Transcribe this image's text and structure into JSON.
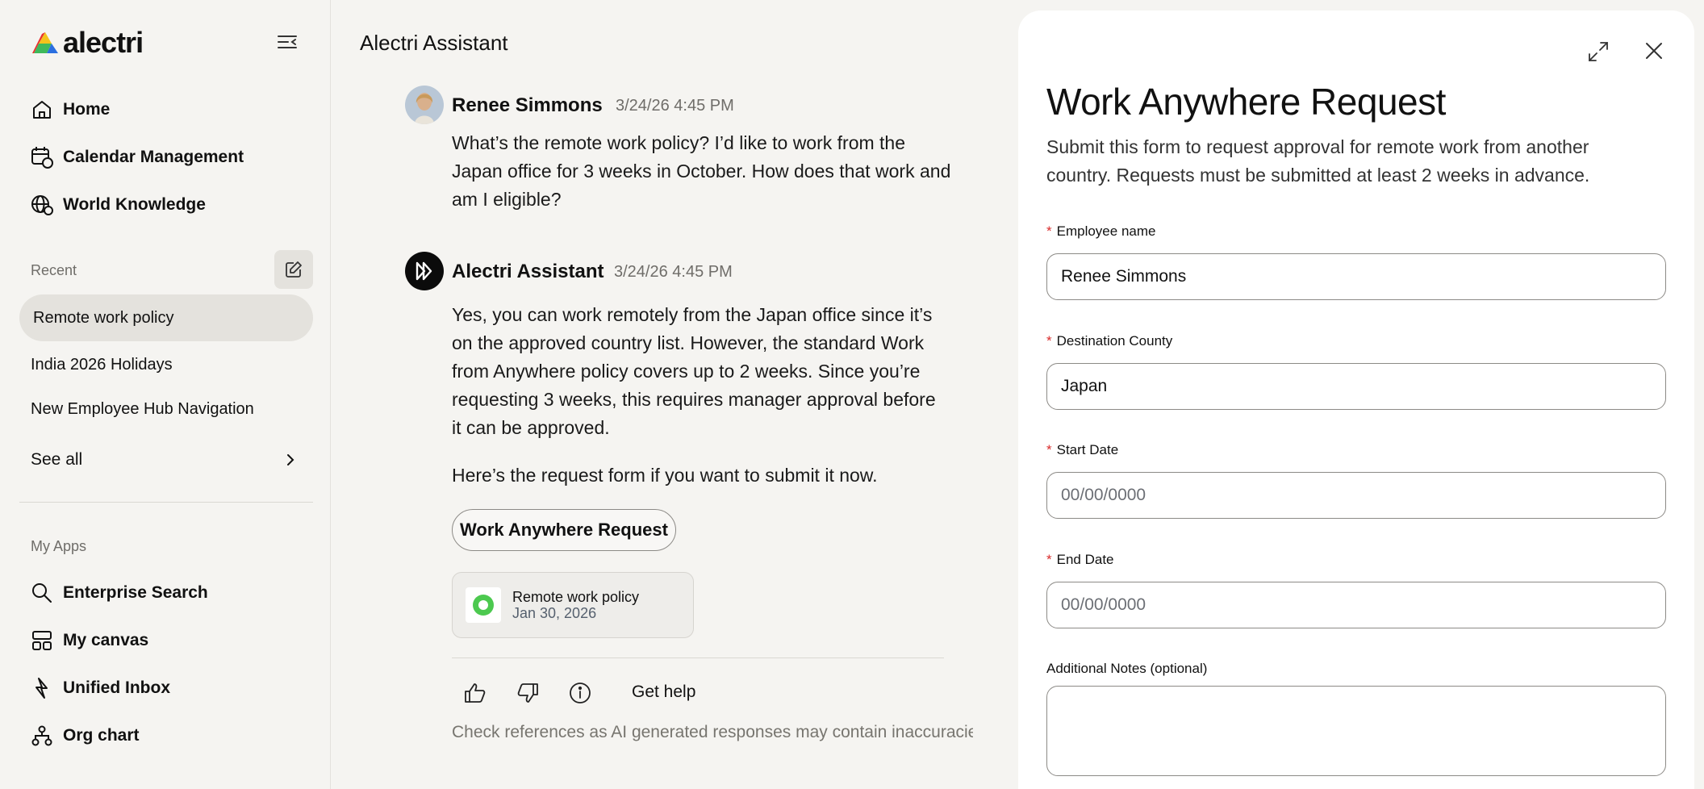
{
  "brand": {
    "name": "alectri",
    "colors": {
      "accent_red": "#e8312f",
      "accent_yellow": "#f4c21c",
      "accent_green": "#2bb34a",
      "accent_blue": "#2b6fe0"
    }
  },
  "sidebar": {
    "nav": [
      {
        "label": "Home",
        "icon": "home-icon"
      },
      {
        "label": "Calendar Management",
        "icon": "calendar-chat-icon"
      },
      {
        "label": "World Knowledge",
        "icon": "globe-chat-icon"
      }
    ],
    "recent_label": "Recent",
    "recent": [
      {
        "label": "Remote work policy",
        "active": true
      },
      {
        "label": "India 2026 Holidays",
        "active": false
      },
      {
        "label": "New Employee Hub Navigation",
        "active": false
      }
    ],
    "see_all": "See all",
    "apps_label": "My Apps",
    "apps": [
      {
        "label": "Enterprise Search",
        "icon": "search-icon"
      },
      {
        "label": "My canvas",
        "icon": "canvas-grid-icon"
      },
      {
        "label": "Unified Inbox",
        "icon": "bolt-icon"
      },
      {
        "label": "Org chart",
        "icon": "org-chart-icon"
      }
    ]
  },
  "chat": {
    "title": "Alectri Assistant",
    "messages": [
      {
        "author": "Renee Simmons",
        "time": "3/24/26 4:45 PM",
        "text": "What’s the remote work policy? I’d like to work from the Japan office for 3 weeks in October. How does that work and am I eligible?"
      },
      {
        "author": "Alectri Assistant",
        "time": "3/24/26 4:45 PM",
        "text": "Yes, you can work remotely from the Japan office since it’s on the approved country list. However, the standard Work from Anywhere policy covers up to 2 weeks. Since you’re requesting 3 weeks, this requires manager approval before it can be approved.",
        "text2": "Here’s the request form if you want to submit it now."
      }
    ],
    "action_button": "Work Anywhere Request",
    "reference": {
      "title": "Remote work policy",
      "date": "Jan 30, 2026"
    },
    "get_help": "Get help",
    "disclaimer": "Check references as AI generated responses may contain inaccuracies"
  },
  "form": {
    "title": "Work Anywhere Request",
    "description": "Submit this form to request approval for remote work from another country. Requests must be submitted at least 2 weeks in advance.",
    "fields": [
      {
        "label": "Employee name",
        "required": true,
        "value": "Renee Simmons",
        "placeholder": ""
      },
      {
        "label": "Destination County",
        "required": true,
        "value": "Japan",
        "placeholder": ""
      },
      {
        "label": "Start Date",
        "required": true,
        "value": "",
        "placeholder": "00/00/0000"
      },
      {
        "label": "End Date",
        "required": true,
        "value": "",
        "placeholder": "00/00/0000"
      },
      {
        "label": "Additional Notes (optional)",
        "required": false,
        "value": "",
        "placeholder": ""
      }
    ]
  }
}
